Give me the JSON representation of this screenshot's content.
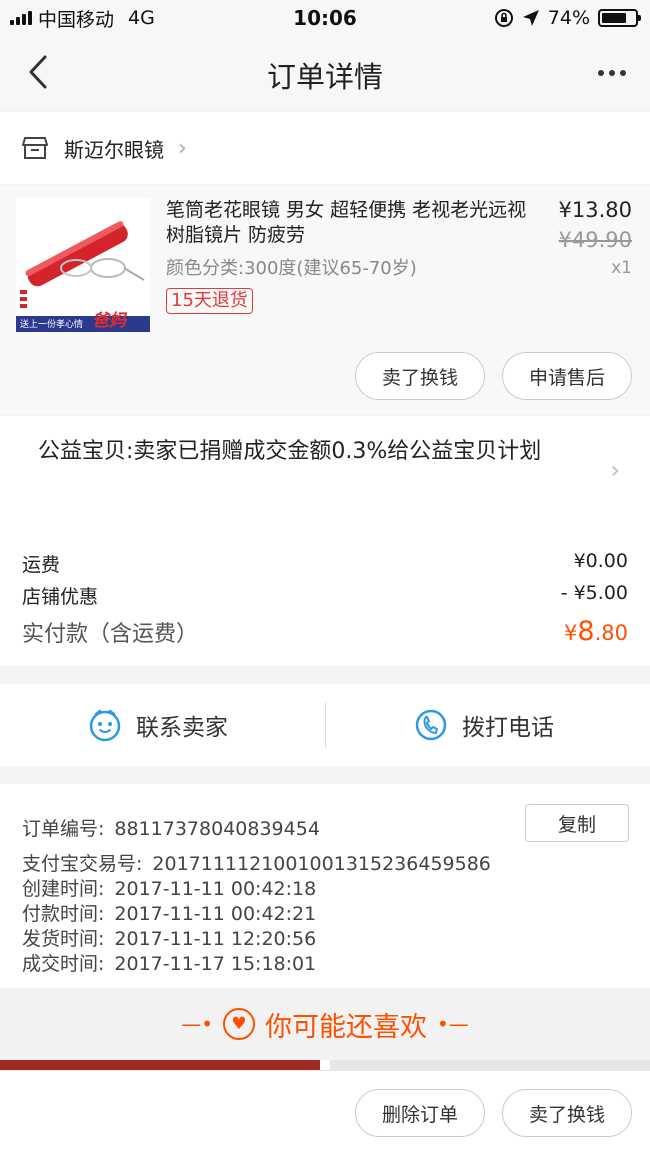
{
  "status_bar": {
    "carrier": "中国移动",
    "network": "4G",
    "time": "10:06",
    "battery": "74%",
    "battery_level": 0.74
  },
  "nav": {
    "title": "订单详情"
  },
  "shop": {
    "name": "斯迈尔眼镜"
  },
  "product": {
    "title": "笔筒老花眼镜 男女 超轻便携 老视老光远视 树脂镜片 防疲劳",
    "spec": "颜色分类:300度(建议65-70岁)",
    "tag": "15天退货",
    "price": "¥13.80",
    "original_price": "¥49.90",
    "quantity": "x1",
    "thumb_caption": "送上一份孝心情",
    "thumb_badge": "爸妈",
    "sell_label": "卖了换钱",
    "after_sales_label": "申请售后"
  },
  "summary": {
    "charity": "公益宝贝:卖家已捐赠成交金额0.3%给公益宝贝计划",
    "shipping_label": "运费",
    "shipping_value": "¥0.00",
    "discount_label": "店铺优惠",
    "discount_value": "- ¥5.00",
    "paid_label": "实付款（含运费）",
    "paid_currency": "¥",
    "paid_int": "8",
    "paid_dec": ".80"
  },
  "contact": {
    "seller_label": "联系卖家",
    "phone_label": "拨打电话"
  },
  "order_info": {
    "copy_label": "复制",
    "lines": [
      {
        "label": "订单编号:",
        "value": "88117378040839454"
      },
      {
        "label": "支付宝交易号:",
        "value": "2017111121001001315236459586"
      },
      {
        "label": "创建时间:",
        "value": "2017-11-11 00:42:18"
      },
      {
        "label": "付款时间:",
        "value": "2017-11-11 00:42:21"
      },
      {
        "label": "发货时间:",
        "value": "2017-11-11 12:20:56"
      },
      {
        "label": "成交时间:",
        "value": "2017-11-17 15:18:01"
      }
    ]
  },
  "reco": {
    "title": "你可能还喜欢"
  },
  "bottom": {
    "delete_label": "删除订单",
    "sell_label": "卖了换钱"
  },
  "colors": {
    "accent": "#ff5000",
    "tag_red": "#e23b3b",
    "icon_blue": "#2a9ae6"
  }
}
